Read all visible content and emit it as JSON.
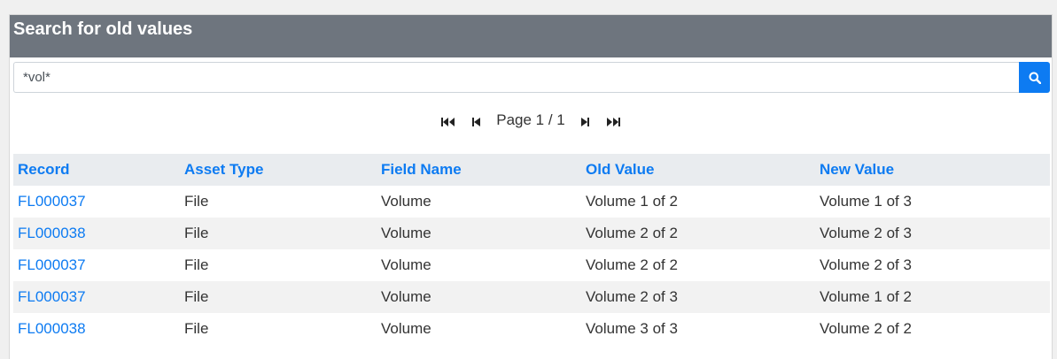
{
  "panel": {
    "title": "Search for old values"
  },
  "search": {
    "value": "*vol*",
    "button_icon": "search-icon"
  },
  "pager": {
    "first_icon": "first-page-icon",
    "prev_icon": "prev-page-icon",
    "text": "Page 1 / 1",
    "next_icon": "next-page-icon",
    "last_icon": "last-page-icon"
  },
  "table": {
    "headers": [
      "Record",
      "Asset Type",
      "Field Name",
      "Old Value",
      "New Value"
    ],
    "rows": [
      [
        "FL000037",
        "File",
        "Volume",
        "Volume 1 of 2",
        "Volume 1 of 3"
      ],
      [
        "FL000038",
        "File",
        "Volume",
        "Volume 2 of 2",
        "Volume 2 of 3"
      ],
      [
        "FL000037",
        "File",
        "Volume",
        "Volume 2 of 2",
        "Volume 2 of 3"
      ],
      [
        "FL000037",
        "File",
        "Volume",
        "Volume 2 of 3",
        "Volume 1 of 2"
      ],
      [
        "FL000038",
        "File",
        "Volume",
        "Volume 3 of 3",
        "Volume 2 of 2"
      ]
    ]
  },
  "colors": {
    "header_bg": "#6e757e",
    "accent": "#0d7bf2",
    "table_head_bg": "#e9ecef"
  }
}
